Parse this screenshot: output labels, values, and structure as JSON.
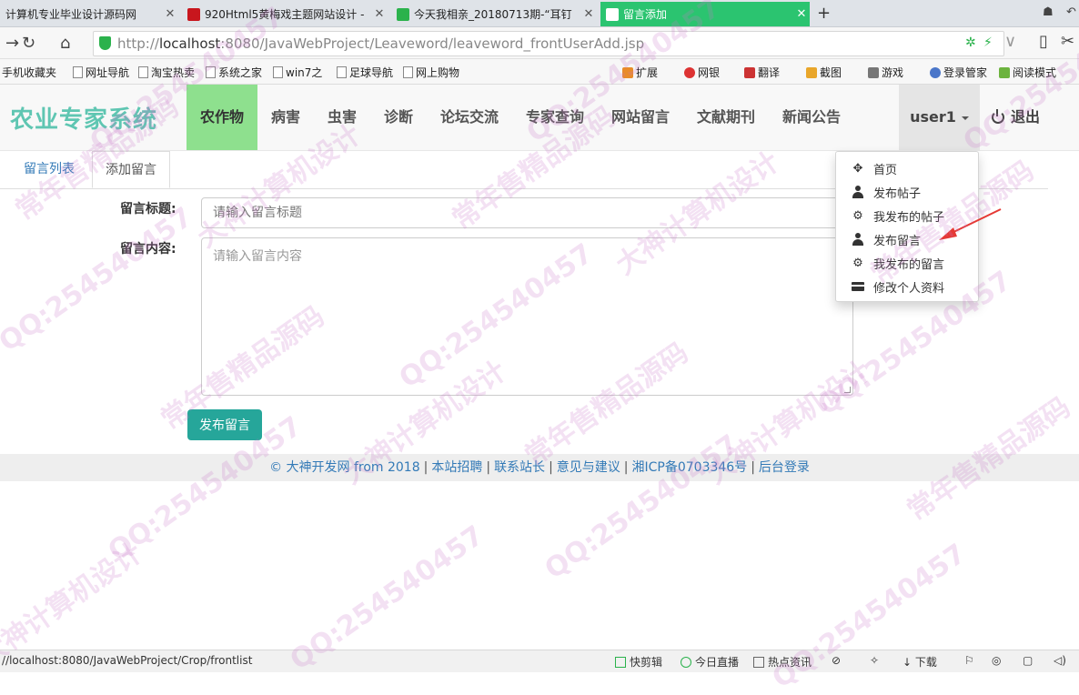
{
  "browser": {
    "tabs": [
      {
        "title": "计算机专业毕业设计源码网",
        "active": false
      },
      {
        "title": "920Html5黄梅戏主题网站设计 -",
        "active": false
      },
      {
        "title": "今天我相亲_20180713期-“耳钉",
        "active": false
      },
      {
        "title": "留言添加",
        "active": true
      }
    ],
    "new_tab": "+",
    "url_prefix": "http://",
    "url_host": "localhost",
    "url_rest": ":8080/JavaWebProject/Leaveword/leaveword_frontUserAdd.jsp",
    "bookmarks": [
      "手机收藏夹",
      "网址导航",
      "淘宝热卖",
      "系统之家",
      "win7之",
      "足球导航",
      "网上购物"
    ],
    "bookmarks_right": [
      "扩展",
      "网银",
      "翻译",
      "截图",
      "游戏",
      "登录管家",
      "阅读模式"
    ]
  },
  "site": {
    "brand": "农业专家系统",
    "nav": [
      "农作物",
      "病害",
      "虫害",
      "诊断",
      "论坛交流",
      "专家查询",
      "网站留言",
      "文献期刊",
      "新闻公告"
    ],
    "active_nav": 0,
    "user": "user1",
    "logout": "退出"
  },
  "page_tabs": {
    "list": "留言列表",
    "add": "添加留言"
  },
  "form": {
    "title_label": "留言标题:",
    "title_placeholder": "请输入留言标题",
    "content_label": "留言内容:",
    "content_placeholder": "请输入留言内容",
    "submit": "发布留言"
  },
  "dropdown": [
    {
      "label": "首页",
      "icon": "move-icon"
    },
    {
      "label": "发布帖子",
      "icon": "user-icon"
    },
    {
      "label": "我发布的帖子",
      "icon": "cog-icon"
    },
    {
      "label": "发布留言",
      "icon": "user-icon"
    },
    {
      "label": "我发布的留言",
      "icon": "cog-icon"
    },
    {
      "label": "修改个人资料",
      "icon": "credit-card-icon"
    }
  ],
  "footer": {
    "copyright": "© 大神开发网 from 2018",
    "links": [
      "本站招聘",
      "联系站长",
      "意见与建议",
      "湘ICP备0703346号",
      "后台登录"
    ]
  },
  "statusbar": {
    "url": "//localhost:8080/JavaWebProject/Crop/frontlist",
    "items": [
      "快剪辑",
      "今日直播",
      "热点资讯",
      "下载"
    ]
  },
  "watermark": {
    "texts": [
      "QQ:254540457",
      "大神计算机设计",
      "常年售精品源码"
    ],
    "color": "#c878c8"
  },
  "colors": {
    "brand": "#5fc6b2",
    "active_nav": "#8ee08e",
    "button": "#26a69a",
    "link": "#337ab7",
    "active_tab": "#2bc470"
  }
}
